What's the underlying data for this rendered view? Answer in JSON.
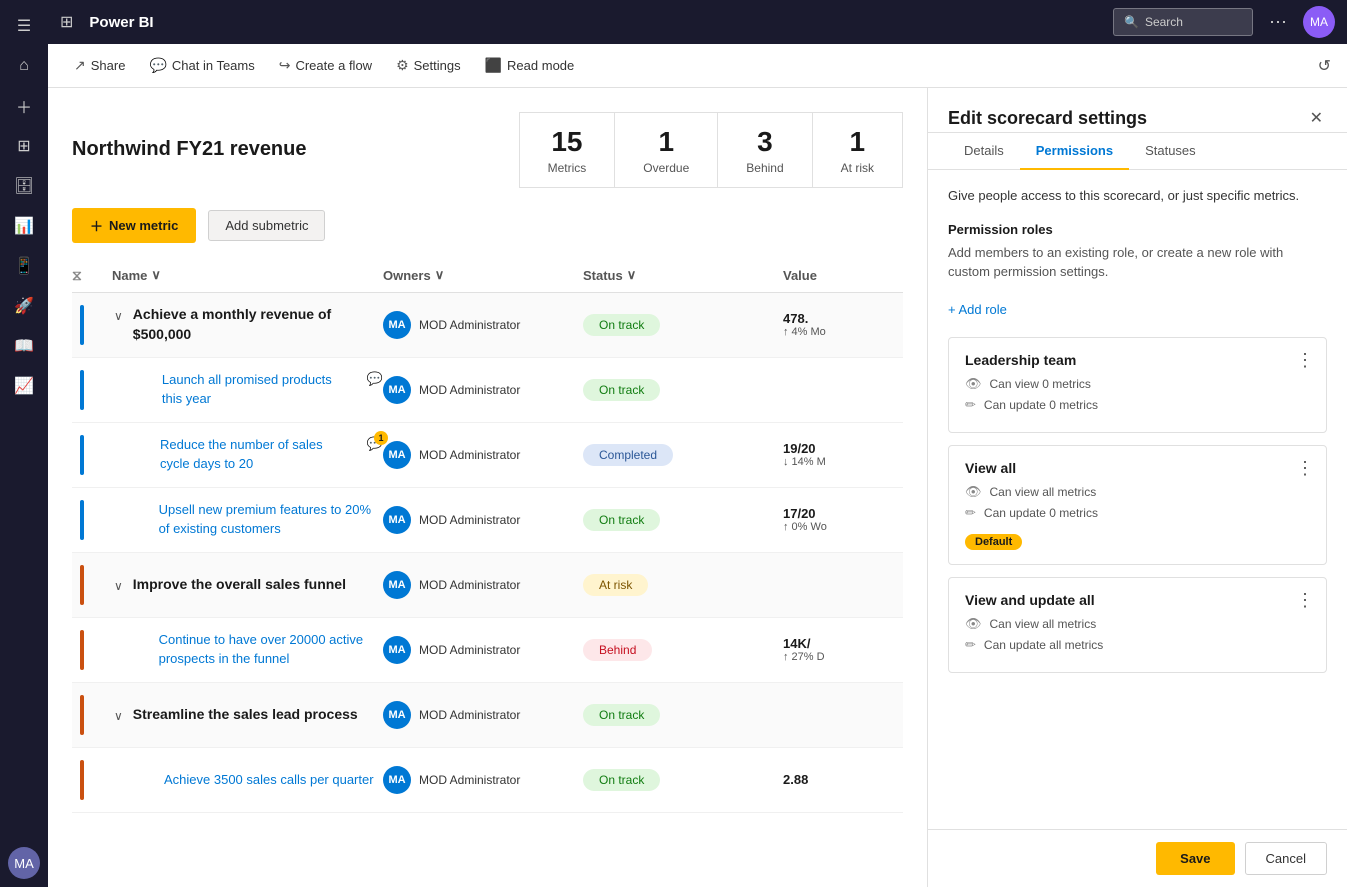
{
  "app": {
    "title": "Power BI",
    "grid_icon": "⊞"
  },
  "topbar": {
    "search_placeholder": "Search",
    "more_icon": "⋯",
    "user_initials": "MA"
  },
  "toolbar": {
    "share_label": "Share",
    "chat_label": "Chat in Teams",
    "flow_label": "Create a flow",
    "settings_label": "Settings",
    "readmode_label": "Read mode"
  },
  "scorecard": {
    "title": "Northwind FY21 revenue",
    "metrics": [
      {
        "num": "15",
        "label": "Metrics"
      },
      {
        "num": "1",
        "label": "Overdue"
      },
      {
        "num": "3",
        "label": "Behind"
      },
      {
        "num": "1",
        "label": "At risk"
      }
    ],
    "new_metric_btn": "New metric",
    "add_submetric_btn": "Add submetric",
    "table_headers": {
      "name": "Name",
      "owners": "Owners",
      "status": "Status",
      "value": "Value"
    },
    "rows": [
      {
        "id": "row1",
        "group": true,
        "bar_color": "bar-blue",
        "expanded": true,
        "name": "Achieve a monthly revenue of $500,000",
        "owner": "MOD Administrator",
        "owner_initials": "MA",
        "status": "On track",
        "status_class": "status-on-track",
        "value": "478.",
        "value_sub": "↑ 4% Mo",
        "has_comment": false,
        "comment_count": ""
      },
      {
        "id": "row2",
        "group": false,
        "bar_color": "bar-blue",
        "expanded": false,
        "name": "Launch all promised products this year",
        "owner": "MOD Administrator",
        "owner_initials": "MA",
        "status": "On track",
        "status_class": "status-on-track",
        "value": "",
        "value_sub": "",
        "has_comment": true,
        "comment_count": ""
      },
      {
        "id": "row3",
        "group": false,
        "bar_color": "bar-blue",
        "expanded": false,
        "name": "Reduce the number of sales cycle days to 20",
        "owner": "MOD Administrator",
        "owner_initials": "MA",
        "status": "Completed",
        "status_class": "status-completed",
        "value": "19/20",
        "value_sub": "↓ 14% M",
        "has_comment": true,
        "comment_count": "1"
      },
      {
        "id": "row4",
        "group": false,
        "bar_color": "bar-blue",
        "expanded": false,
        "name": "Upsell new premium features to 20% of existing customers",
        "owner": "MOD Administrator",
        "owner_initials": "MA",
        "status": "On track",
        "status_class": "status-on-track",
        "value": "17/20",
        "value_sub": "↑ 0% Wo",
        "has_comment": false,
        "comment_count": ""
      },
      {
        "id": "row5",
        "group": true,
        "bar_color": "bar-orange",
        "expanded": true,
        "name": "Improve the overall sales funnel",
        "owner": "MOD Administrator",
        "owner_initials": "MA",
        "status": "At risk",
        "status_class": "status-at-risk",
        "value": "",
        "value_sub": "",
        "has_comment": false,
        "comment_count": ""
      },
      {
        "id": "row6",
        "group": false,
        "bar_color": "bar-orange",
        "expanded": false,
        "name": "Continue to have over 20000 active prospects in the funnel",
        "owner": "MOD Administrator",
        "owner_initials": "MA",
        "status": "Behind",
        "status_class": "status-behind",
        "value": "14K/",
        "value_sub": "↑ 27% D",
        "has_comment": false,
        "comment_count": ""
      },
      {
        "id": "row7",
        "group": true,
        "bar_color": "bar-orange",
        "expanded": true,
        "name": "Streamline the sales lead process",
        "owner": "MOD Administrator",
        "owner_initials": "MA",
        "status": "On track",
        "status_class": "status-on-track",
        "value": "",
        "value_sub": "",
        "has_comment": false,
        "comment_count": ""
      },
      {
        "id": "row8",
        "group": false,
        "bar_color": "bar-orange",
        "expanded": false,
        "name": "Achieve 3500 sales calls per quarter",
        "owner": "MOD Administrator",
        "owner_initials": "MA",
        "status": "On track",
        "status_class": "status-on-track",
        "value": "2.88",
        "value_sub": "",
        "has_comment": false,
        "comment_count": ""
      }
    ]
  },
  "panel": {
    "title": "Edit scorecard settings",
    "tabs": [
      "Details",
      "Permissions",
      "Statuses"
    ],
    "active_tab": "Permissions",
    "description": "Give people access to this scorecard, or just specific metrics.",
    "roles_title": "Permission roles",
    "roles_desc": "Add members to an existing role, or create a new role with custom permission settings.",
    "add_role_label": "+ Add role",
    "roles": [
      {
        "id": "leadership",
        "title": "Leadership team",
        "perms": [
          {
            "icon": "👁",
            "label": "Can view 0 metrics"
          },
          {
            "icon": "✏",
            "label": "Can update 0 metrics"
          }
        ],
        "default": false
      },
      {
        "id": "view-all",
        "title": "View all",
        "perms": [
          {
            "icon": "👁",
            "label": "Can view all metrics"
          },
          {
            "icon": "✏",
            "label": "Can update 0 metrics"
          }
        ],
        "default": true,
        "default_label": "Default"
      },
      {
        "id": "view-update-all",
        "title": "View and update all",
        "perms": [
          {
            "icon": "👁",
            "label": "Can view all metrics"
          },
          {
            "icon": "✏",
            "label": "Can update all metrics"
          }
        ],
        "default": false
      }
    ],
    "save_label": "Save",
    "cancel_label": "Cancel"
  }
}
